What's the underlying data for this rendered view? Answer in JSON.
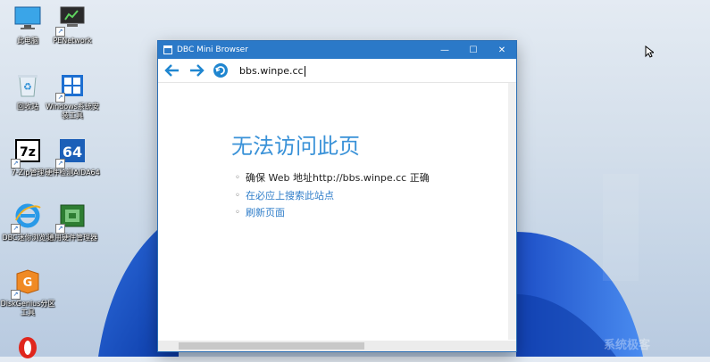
{
  "desktop": {
    "icons": [
      {
        "label": "此电脑",
        "icon": "monitor-icon"
      },
      {
        "label": "PENetwork",
        "icon": "network-icon"
      },
      {
        "label": "回收站",
        "icon": "recycle-bin-icon"
      },
      {
        "label": "Windows系统安装工具",
        "icon": "windows-setup-icon"
      },
      {
        "label": "7-Zip管理",
        "icon": "7zip-icon"
      },
      {
        "label": "硬件检测AIDA64",
        "icon": "aida64-icon"
      },
      {
        "label": "DBC迷你浏览器",
        "icon": "ie-icon"
      },
      {
        "label": "通用硬件管理器",
        "icon": "hardware-icon"
      },
      {
        "label": "DiskGenius分区工具",
        "icon": "diskgenius-icon"
      },
      {
        "label": "",
        "icon": "opera-icon"
      }
    ],
    "watermark": "系统极客"
  },
  "window": {
    "title": "DBC Mini Browser",
    "address": "bbs.winpe.cc",
    "error_title": "无法访问此页",
    "suggestions": [
      "确保 Web 地址http://bbs.winpe.cc 正确",
      "在必应上搜索此站点",
      "刷新页面"
    ]
  },
  "colors": {
    "titlebar": "#2b79c8",
    "link": "#2f7dc9",
    "error_title": "#3a92d8",
    "nav_icon": "#1f86d0"
  }
}
